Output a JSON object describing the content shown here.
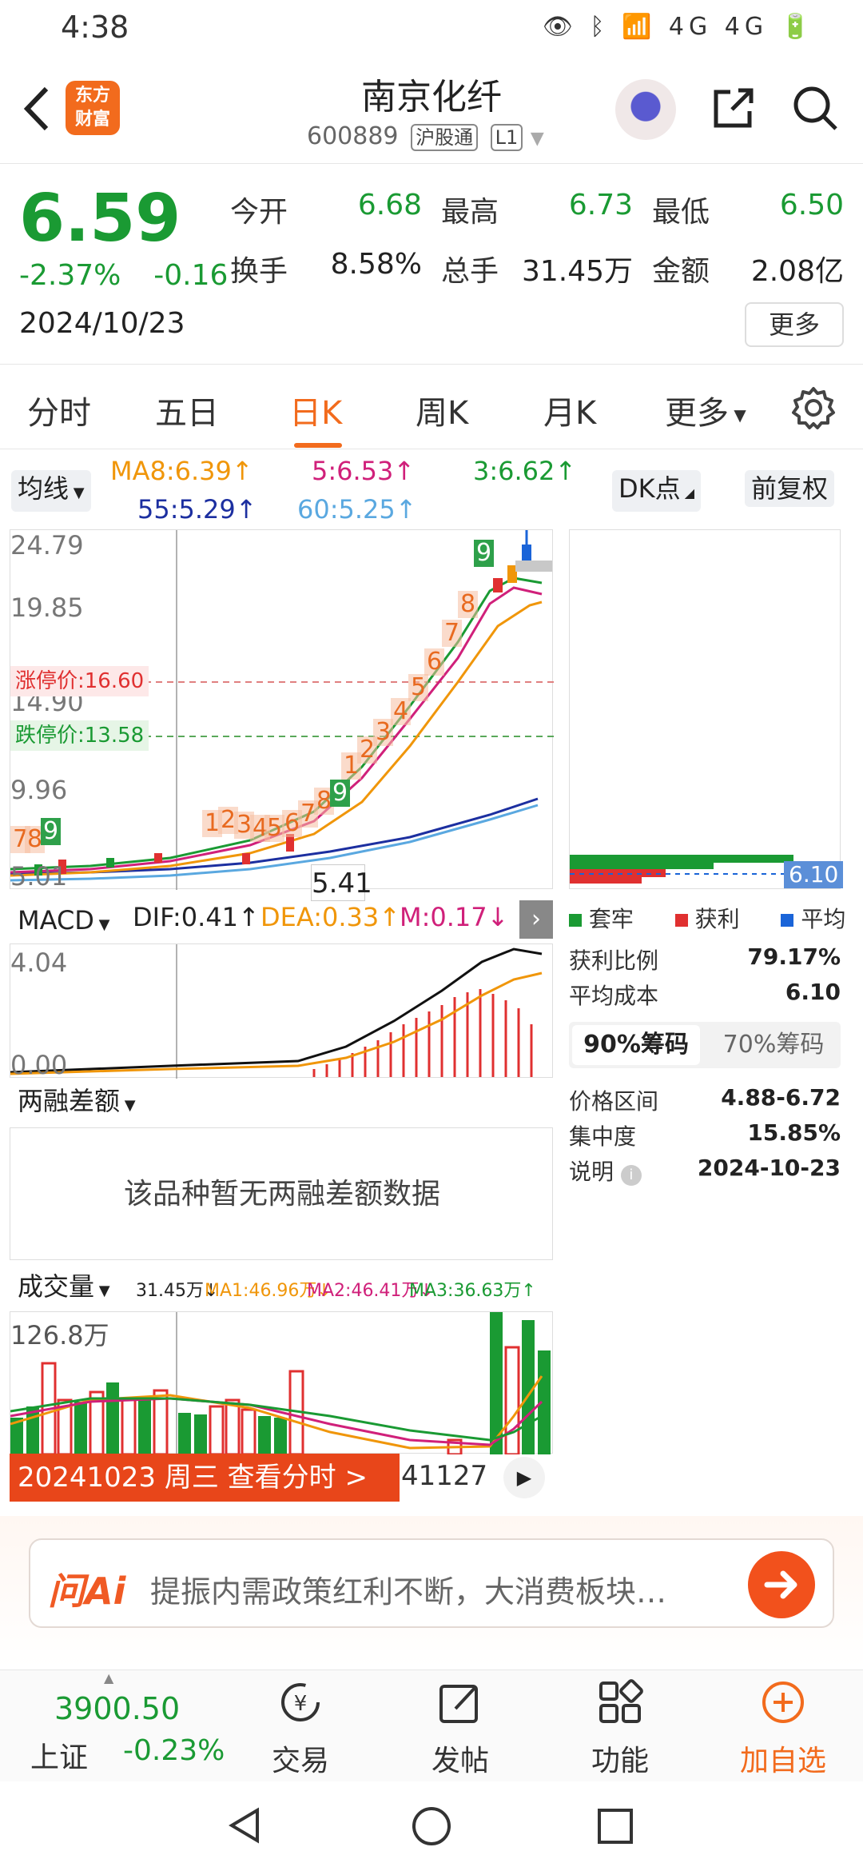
{
  "status_bar": {
    "time": "4:38",
    "icons_text": "👁 ᛒ 📶 4G 4G 🔋"
  },
  "header": {
    "logo_line1": "东方",
    "logo_line2": "财富",
    "stock_name": "南京化纤",
    "stock_code": "600889",
    "tag_connect": "沪股通",
    "tag_level": "L1"
  },
  "quote": {
    "price": "6.59",
    "change_pct": "-2.37%",
    "change_abs": "-0.16",
    "date": "2024/10/23",
    "open_label": "今开",
    "open": "6.68",
    "high_label": "最高",
    "high": "6.73",
    "low_label": "最低",
    "low": "6.50",
    "turnover_label": "换手",
    "turnover": "8.58%",
    "volume_label": "总手",
    "volume": "31.45万",
    "amount_label": "金额",
    "amount": "2.08亿",
    "more_label": "更多"
  },
  "tabs": {
    "items": [
      "分时",
      "五日",
      "日K",
      "周K",
      "月K",
      "更多"
    ],
    "active": "日K"
  },
  "ma_bar": {
    "selector": "均线",
    "ma8": "MA8:6.39↑",
    "ma5": "5:6.53↑",
    "ma3": "3:6.62↑",
    "ma55": "55:5.29↑",
    "ma60": "60:5.25↑",
    "dk_label": "DK点",
    "adjust_label": "前复权"
  },
  "kline": {
    "y_labels": [
      "24.79",
      "19.85",
      "14.90",
      "9.96",
      "5.01"
    ],
    "limit_up": "涨停价:16.60",
    "limit_down": "跌停价:13.58",
    "crosshair_value": "5.41",
    "td_up_counts": [
      "1",
      "2",
      "3",
      "4",
      "5",
      "6",
      "7",
      "8",
      "9"
    ],
    "td_early": [
      "1",
      "2",
      "3",
      "4",
      "5",
      "6",
      "7",
      "8"
    ],
    "td_first": [
      "7",
      "8",
      "9"
    ]
  },
  "macd": {
    "selector": "MACD",
    "dif": "DIF:0.41↑",
    "dea": "DEA:0.33↑",
    "m": "M:0.17↓",
    "y_top": "4.04",
    "y_bottom": "0.00"
  },
  "margin": {
    "selector": "两融差额",
    "empty_text": "该品种暂无两融差额数据"
  },
  "volume": {
    "selector": "成交量",
    "vol": "31.45万↓",
    "ma1": "MA1:46.96万↓",
    "ma2": "MA2:46.41万↓",
    "ma3": "MA3:36.63万↑",
    "y_top": "126.8万",
    "banner": "20241023 周三 查看分时 >",
    "banner_tail": "41127"
  },
  "chips": {
    "avg_cost_tag": "6.10",
    "legend": [
      "套牢",
      "获利",
      "平均"
    ],
    "profit_ratio_label": "获利比例",
    "profit_ratio": "79.17%",
    "avg_cost_label": "平均成本",
    "avg_cost": "6.10",
    "tab_90": "90%筹码",
    "tab_70": "70%筹码",
    "range_label": "价格区间",
    "range": "4.88-6.72",
    "concentration_label": "集中度",
    "concentration": "15.85%",
    "note_label": "说明",
    "note_date": "2024-10-23"
  },
  "ai": {
    "logo": "问Ai",
    "text": "提振内需政策红利不断，大消费板块…"
  },
  "bottom_nav": {
    "index_value": "3900.50",
    "index_name": "上证",
    "index_change": "-0.23%",
    "trade": "交易",
    "post": "发帖",
    "function": "功能",
    "add": "加自选"
  },
  "colors": {
    "up": "#e03030",
    "down": "#1a9a33",
    "accent": "#f26b1d"
  }
}
